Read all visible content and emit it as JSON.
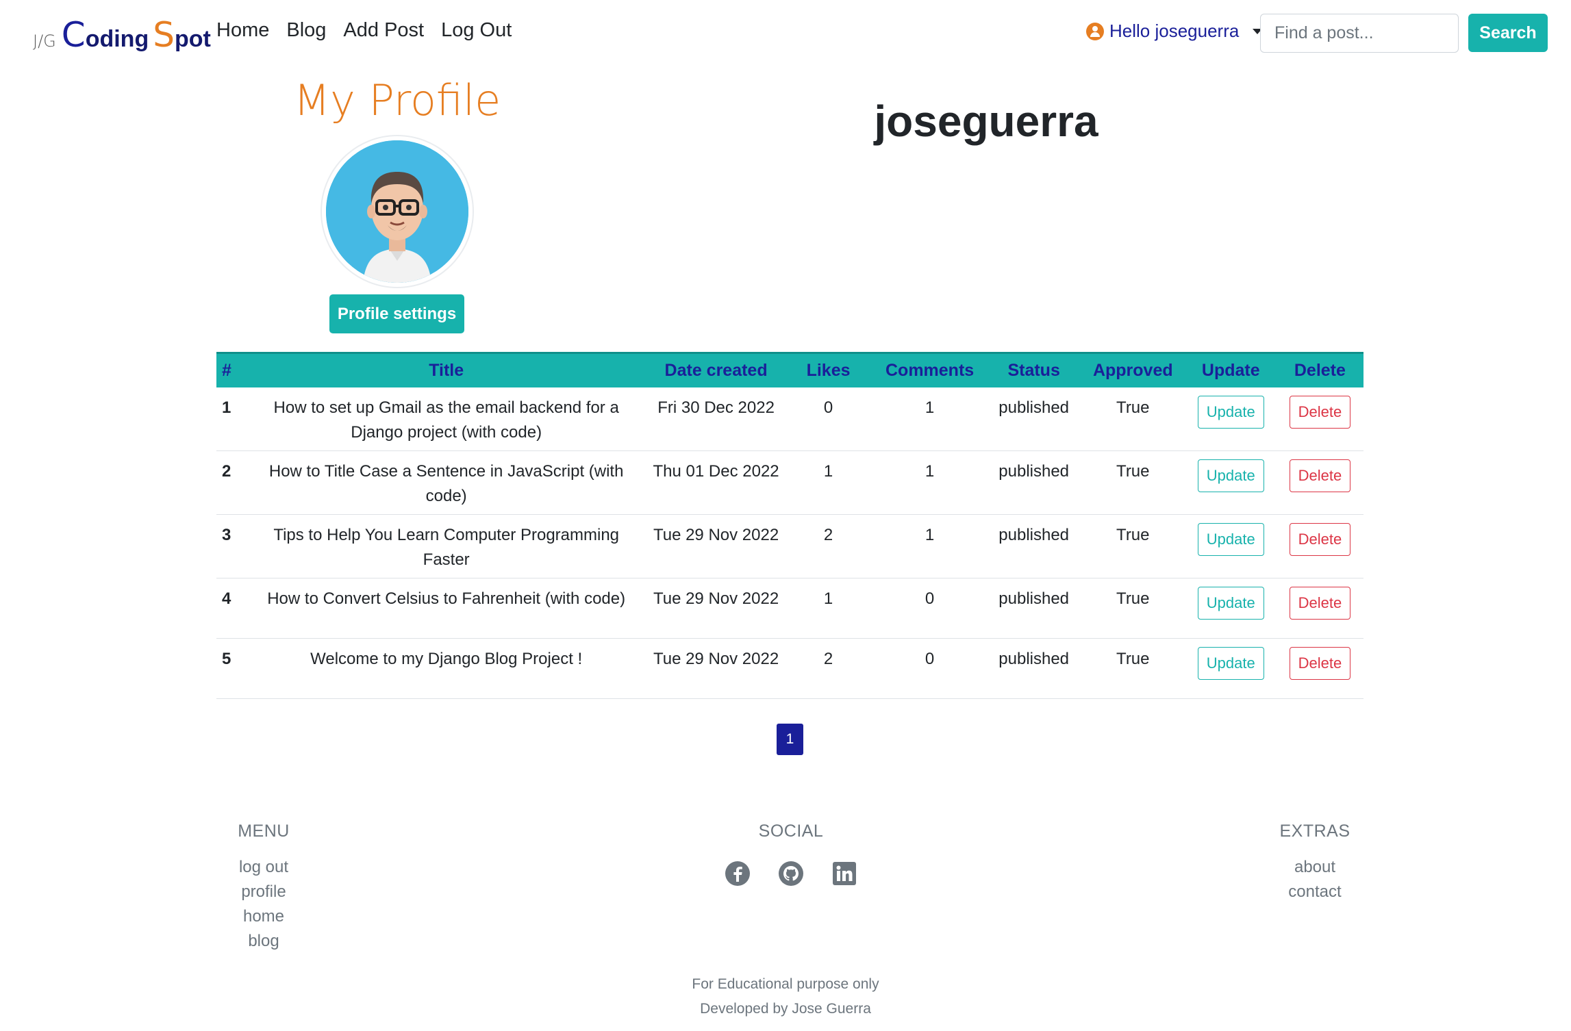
{
  "brand": {
    "prefix": "J/G",
    "c": "C",
    "word1": "oding",
    "s": "S",
    "word2": "pot"
  },
  "nav": {
    "links": [
      "Home",
      "Blog",
      "Add Post",
      "Log Out"
    ]
  },
  "user_menu": {
    "label": "Hello joseguerra"
  },
  "search": {
    "placeholder": "Find a post...",
    "button": "Search"
  },
  "profile": {
    "heading": "My Profile",
    "username": "joseguerra",
    "settings_button": "Profile settings"
  },
  "table": {
    "headers": [
      "#",
      "Title",
      "Date created",
      "Likes",
      "Comments",
      "Status",
      "Approved",
      "Update",
      "Delete"
    ],
    "rows": [
      {
        "num": "1",
        "title": "How to set up Gmail as the email backend for a Django project (with code)",
        "date": "Fri 30 Dec 2022",
        "likes": "0",
        "comments": "1",
        "status": "published",
        "approved": "True",
        "update": "Update",
        "delete": "Delete"
      },
      {
        "num": "2",
        "title": "How to Title Case a Sentence in JavaScript (with code)",
        "date": "Thu 01 Dec 2022",
        "likes": "1",
        "comments": "1",
        "status": "published",
        "approved": "True",
        "update": "Update",
        "delete": "Delete"
      },
      {
        "num": "3",
        "title": "Tips to Help You Learn Computer Programming Faster",
        "date": "Tue 29 Nov 2022",
        "likes": "2",
        "comments": "1",
        "status": "published",
        "approved": "True",
        "update": "Update",
        "delete": "Delete"
      },
      {
        "num": "4",
        "title": "How to Convert Celsius to Fahrenheit (with code)",
        "date": "Tue 29 Nov 2022",
        "likes": "1",
        "comments": "0",
        "status": "published",
        "approved": "True",
        "update": "Update",
        "delete": "Delete"
      },
      {
        "num": "5",
        "title": "Welcome to my Django Blog Project !",
        "date": "Tue 29 Nov 2022",
        "likes": "2",
        "comments": "0",
        "status": "published",
        "approved": "True",
        "update": "Update",
        "delete": "Delete"
      }
    ]
  },
  "pagination": {
    "current": "1"
  },
  "footer": {
    "menu": {
      "heading": "MENU",
      "links": [
        "log out",
        "profile",
        "home",
        "blog"
      ]
    },
    "social": {
      "heading": "SOCIAL",
      "icons": [
        "facebook-icon",
        "github-icon",
        "linkedin-icon"
      ]
    },
    "extras": {
      "heading": "EXTRAS",
      "links": [
        "about",
        "contact"
      ]
    },
    "note1": "For Educational purpose only",
    "note2": "Developed by Jose Guerra"
  },
  "colors": {
    "accent": "#17b2ac",
    "brand_orange": "#e67e22",
    "navy": "#1a1f99",
    "danger": "#dc3545"
  }
}
